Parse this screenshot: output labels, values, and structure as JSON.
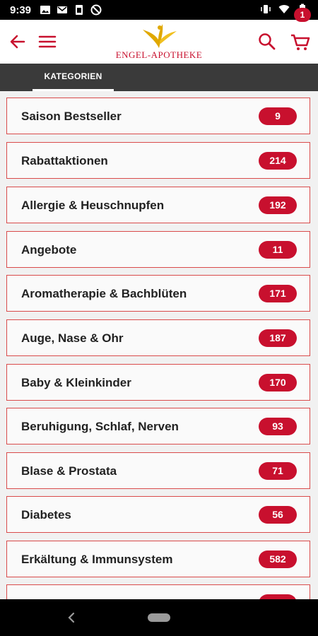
{
  "status": {
    "time": "9:39"
  },
  "header": {
    "logo_text": "ENGEL-APOTHEKE",
    "cart_count": "1"
  },
  "tabs": {
    "active_label": "KATEGORIEN"
  },
  "categories": [
    {
      "label": "Saison Bestseller",
      "count": "9"
    },
    {
      "label": "Rabattaktionen",
      "count": "214"
    },
    {
      "label": "Allergie & Heuschnupfen",
      "count": "192"
    },
    {
      "label": "Angebote",
      "count": "11"
    },
    {
      "label": "Aromatherapie & Bachblüten",
      "count": "171"
    },
    {
      "label": "Auge, Nase & Ohr",
      "count": "187"
    },
    {
      "label": "Baby & Kleinkinder",
      "count": "170"
    },
    {
      "label": "Beruhigung, Schlaf, Nerven",
      "count": "93"
    },
    {
      "label": "Blase & Prostata",
      "count": "71"
    },
    {
      "label": "Diabetes",
      "count": "56"
    },
    {
      "label": "Erkältung & Immunsystem",
      "count": "582"
    }
  ],
  "colors": {
    "brand_red": "#c8102e",
    "tab_bar": "#3a3a3a",
    "logo_gold": "#e0a800"
  }
}
